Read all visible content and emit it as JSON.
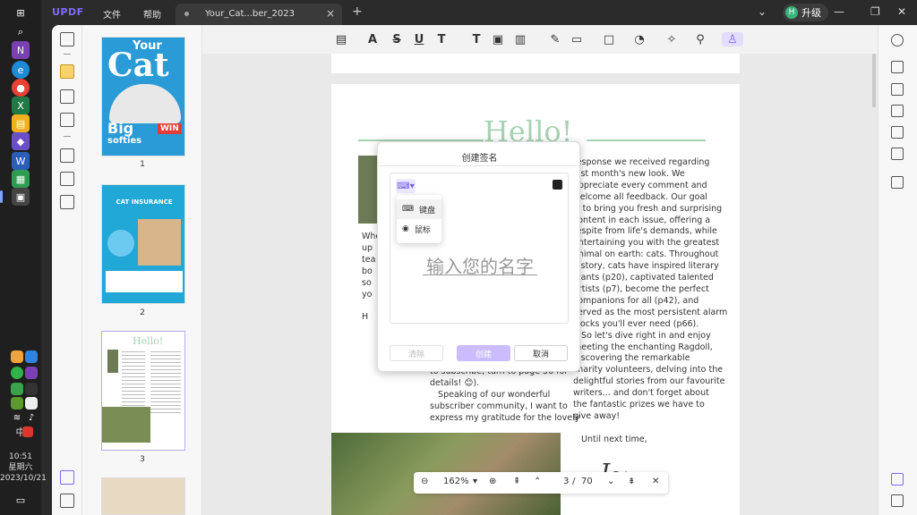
{
  "app": {
    "logo": "UPDF",
    "menu": [
      "文件",
      "帮助"
    ],
    "tab_title": "Your_Cat...ber_2023",
    "upgrade_label": "升级",
    "avatar_letter": "H"
  },
  "system": {
    "time": "10:51",
    "weekday": "星期六",
    "date": "2023/10/21",
    "ime": "中"
  },
  "thumbnails": [
    {
      "page": "1",
      "cover_text_1": "Your",
      "cover_text_2": "Cat",
      "cover_text_3": "Big",
      "cover_text_4": "softies",
      "cover_badge": "WIN"
    },
    {
      "page": "2",
      "title": "CAT INSURANCE"
    },
    {
      "page": "3",
      "title": "Hello!"
    }
  ],
  "page": {
    "heading": "Hello!",
    "left_col_lines": [
      "Whe",
      "up",
      "tea o",
      "bo",
      "so",
      "yo",
      "",
      "H"
    ],
    "left_col_bottom": [
      "to subscribe, turn to page 56 for",
      "details! 😊).",
      "   Speaking of our wonderful",
      "subscriber community, I want to",
      "express my gratitude for the lovely"
    ],
    "right_col": [
      "response we received regarding",
      "last month's new look. We",
      "appreciate every comment and",
      "welcome all feedback. Our goal",
      "is to bring you fresh and surprising",
      "content in each issue, offering a",
      "respite from life's demands, while",
      "entertaining you with the greatest",
      "animal on earth: cats. Throughout",
      "history, cats have inspired literary",
      "giants (p20), captivated talented",
      "artists (p7), become the perfect",
      "companions for all (p42), and",
      "served as the most persistent alarm",
      "clocks you'll ever need (p66).",
      "   So let's dive right in and enjoy",
      "meeting the enchanting Ragdoll,",
      "discovering the remarkable",
      "charity volunteers, delving into the",
      "delightful stories from our favourite",
      "writers... and don't forget about",
      "the fantastic prizes we have to",
      "give away!",
      "",
      "   Until next time,"
    ]
  },
  "dialog": {
    "title": "创建签名",
    "placeholder": "输入您的名字",
    "dropdown": [
      {
        "label": "键盘",
        "icon": "keyboard-icon"
      },
      {
        "label": "鼠标",
        "icon": "mouse-icon"
      }
    ],
    "btn_clear": "清除",
    "btn_create": "创建",
    "btn_cancel": "取消",
    "ink_color": "#222222"
  },
  "zoom": {
    "level": "162%",
    "current_page": "3",
    "total_pages": "70",
    "separator": "/"
  },
  "colors": {
    "accent": "#7d6bff",
    "heading_green": "#a7d3b3"
  }
}
